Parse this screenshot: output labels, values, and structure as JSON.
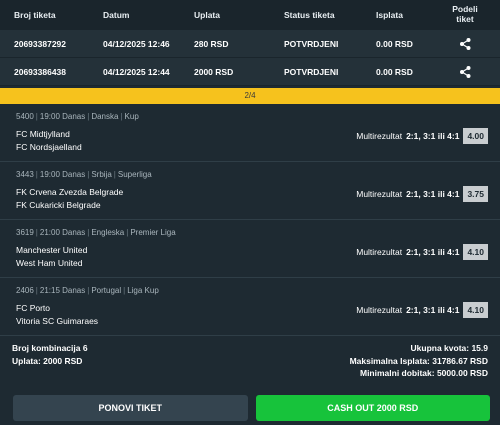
{
  "header": {
    "ticket_id": "Broj tiketa",
    "date": "Datum",
    "payment": "Uplata",
    "status": "Status tiketa",
    "payout": "Isplata",
    "share": "Podeli tiket"
  },
  "tickets": [
    {
      "id": "20693387292",
      "date": "04/12/2025 12:46",
      "payment": "280 RSD",
      "status": "POTVRDJENI",
      "payout": "0.00 RSD",
      "share_icon": "share-icon"
    },
    {
      "id": "20693386438",
      "date": "04/12/2025 12:44",
      "payment": "2000 RSD",
      "status": "POTVRDJENI",
      "payout": "0.00 RSD",
      "share_icon": "share-icon"
    }
  ],
  "pager": "2/4",
  "events": [
    {
      "code": "5400",
      "time": "19:00 Danas",
      "country": "Danska",
      "league": "Kup",
      "home": "FC Midtjylland",
      "away": "FC Nordsjaelland",
      "market": "Multirezultat",
      "pick": "2:1, 3:1 ili 4:1",
      "odd": "4.00"
    },
    {
      "code": "3443",
      "time": "19:00 Danas",
      "country": "Srbija",
      "league": "Superliga",
      "home": "FK Crvena Zvezda Belgrade",
      "away": "FK Cukaricki Belgrade",
      "market": "Multirezultat",
      "pick": "2:1, 3:1 ili 4:1",
      "odd": "3.75"
    },
    {
      "code": "3619",
      "time": "21:00 Danas",
      "country": "Engleska",
      "league": "Premier Liga",
      "home": "Manchester United",
      "away": "West Ham United",
      "market": "Multirezultat",
      "pick": "2:1, 3:1 ili 4:1",
      "odd": "4.10"
    },
    {
      "code": "2406",
      "time": "21:15 Danas",
      "country": "Portugal",
      "league": "Liga Kup",
      "home": "FC Porto",
      "away": "Vitoria SC Guimaraes",
      "market": "Multirezultat",
      "pick": "2:1, 3:1 ili 4:1",
      "odd": "4.10"
    }
  ],
  "summary": {
    "combinations": "Broj kombinacija 6",
    "payment": "Uplata: 2000 RSD",
    "total_odd": "Ukupna kvota: 15.9",
    "max_payout": "Maksimalna Isplata: 31786.67 RSD",
    "min_win": "Minimalni dobitak: 5000.00 RSD"
  },
  "actions": {
    "repeat": "PONOVI TIKET",
    "cashout": "CASH OUT 2000 RSD"
  },
  "colors": {
    "background": "#1e2a32",
    "pager": "#f6c21d",
    "cashout": "#17c33b",
    "repeat": "#34444f",
    "odd_badge": "#c9cdd0"
  }
}
